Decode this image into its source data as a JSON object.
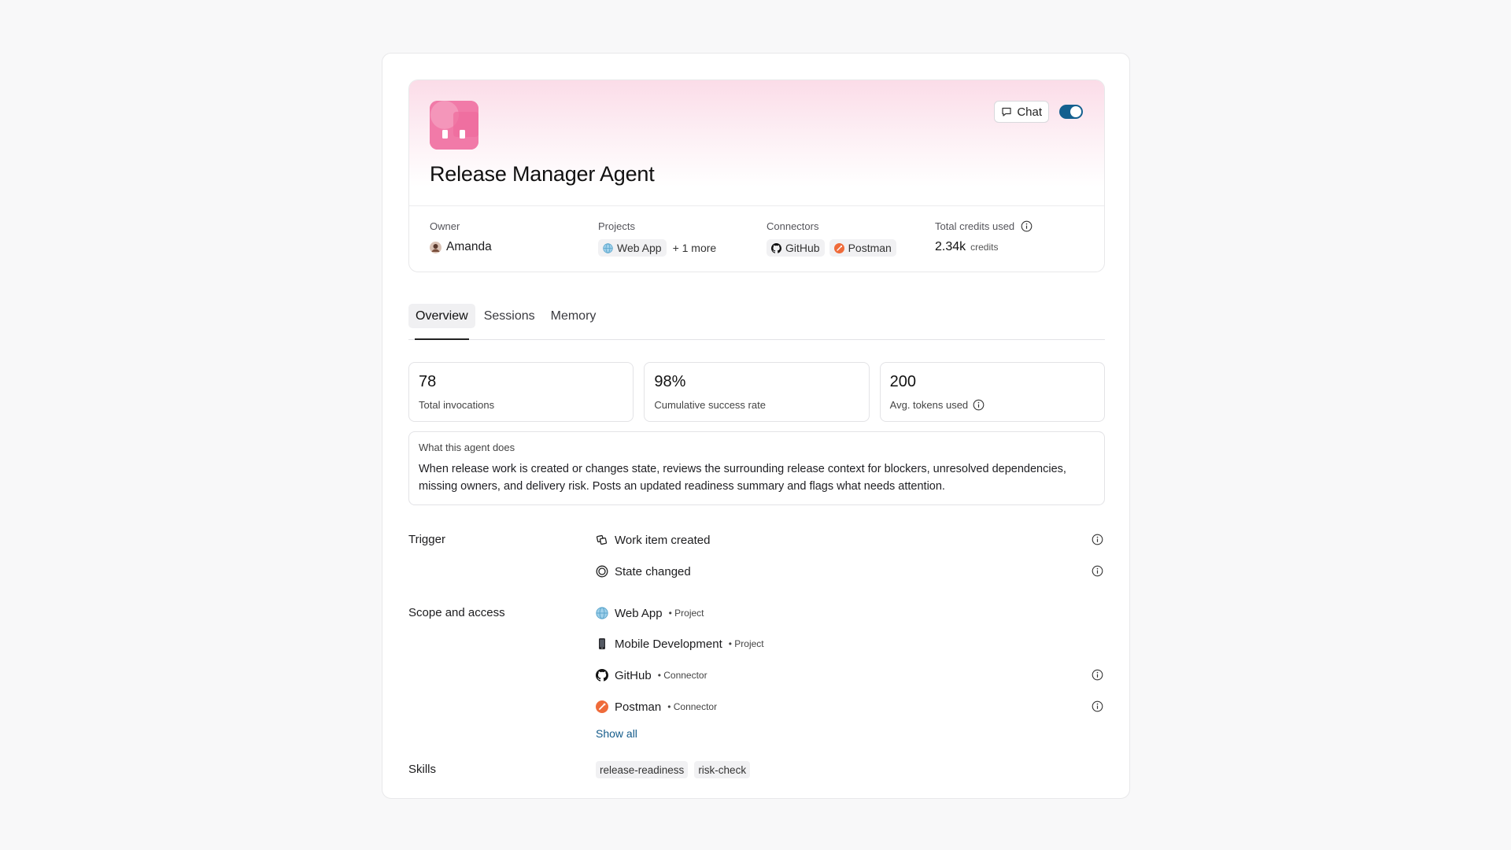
{
  "agent": {
    "title": "Release Manager Agent",
    "chat_label": "Chat",
    "enabled": true
  },
  "meta": {
    "owner_label": "Owner",
    "owner_name": "Amanda",
    "projects_label": "Projects",
    "project_chip": "Web App",
    "projects_more": "+ 1 more",
    "connectors_label": "Connectors",
    "connectors": [
      "GitHub",
      "Postman"
    ],
    "credits_label": "Total credits used",
    "credits_value": "2.34k",
    "credits_unit": "credits"
  },
  "tabs": [
    "Overview",
    "Sessions",
    "Memory"
  ],
  "active_tab": "Overview",
  "stats": [
    {
      "value": "78",
      "label": "Total invocations"
    },
    {
      "value": "98%",
      "label": "Cumulative success rate"
    },
    {
      "value": "200",
      "label": "Avg. tokens used"
    }
  ],
  "description": {
    "label": "What this agent does",
    "text": "When release work is created or changes state, reviews the surrounding release context for blockers, unresolved dependencies, missing owners, and delivery risk. Posts an updated readiness summary and flags what needs attention."
  },
  "trigger": {
    "label": "Trigger",
    "items": [
      "Work item created",
      "State changed"
    ]
  },
  "scope": {
    "label": "Scope and access",
    "items": [
      {
        "name": "Web App",
        "type": "• Project"
      },
      {
        "name": "Mobile Development",
        "type": "• Project"
      },
      {
        "name": "GitHub",
        "type": "• Connector"
      },
      {
        "name": "Postman",
        "type": "• Connector"
      }
    ],
    "show_all": "Show all"
  },
  "skills": {
    "label": "Skills",
    "items": [
      "release-readiness",
      "risk-check"
    ]
  },
  "colors": {
    "accent": "#14608f",
    "brand_pink": "#f17aa8",
    "postman_orange": "#ef6b3a"
  }
}
